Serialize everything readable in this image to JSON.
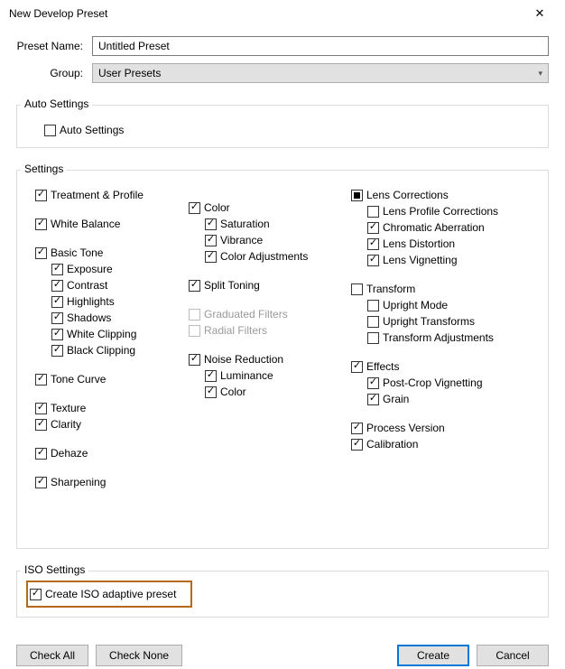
{
  "window": {
    "title": "New Develop Preset"
  },
  "form": {
    "preset_name_label": "Preset Name:",
    "preset_name_value": "Untitled Preset",
    "group_label": "Group:",
    "group_value": "User Presets"
  },
  "autosettings": {
    "legend": "Auto Settings",
    "auto_settings": "Auto Settings"
  },
  "settings": {
    "legend": "Settings",
    "col1": {
      "treatment_profile": "Treatment & Profile",
      "white_balance": "White Balance",
      "basic_tone": "Basic Tone",
      "exposure": "Exposure",
      "contrast": "Contrast",
      "highlights": "Highlights",
      "shadows": "Shadows",
      "white_clipping": "White Clipping",
      "black_clipping": "Black Clipping",
      "tone_curve": "Tone Curve",
      "texture": "Texture",
      "clarity": "Clarity",
      "dehaze": "Dehaze",
      "sharpening": "Sharpening"
    },
    "col2": {
      "color": "Color",
      "saturation": "Saturation",
      "vibrance": "Vibrance",
      "color_adjustments": "Color Adjustments",
      "split_toning": "Split Toning",
      "graduated_filters": "Graduated Filters",
      "radial_filters": "Radial Filters",
      "noise_reduction": "Noise Reduction",
      "luminance": "Luminance",
      "nr_color": "Color"
    },
    "col3": {
      "lens_corrections": "Lens Corrections",
      "lens_profile_corrections": "Lens Profile Corrections",
      "chromatic_aberration": "Chromatic Aberration",
      "lens_distortion": "Lens Distortion",
      "lens_vignetting": "Lens Vignetting",
      "transform": "Transform",
      "upright_mode": "Upright Mode",
      "upright_transforms": "Upright Transforms",
      "transform_adjustments": "Transform Adjustments",
      "effects": "Effects",
      "post_crop_vignetting": "Post-Crop Vignetting",
      "grain": "Grain",
      "process_version": "Process Version",
      "calibration": "Calibration"
    }
  },
  "iso": {
    "legend": "ISO Settings",
    "create_iso_adaptive": "Create ISO adaptive preset"
  },
  "buttons": {
    "check_all": "Check All",
    "check_none": "Check None",
    "create": "Create",
    "cancel": "Cancel"
  }
}
